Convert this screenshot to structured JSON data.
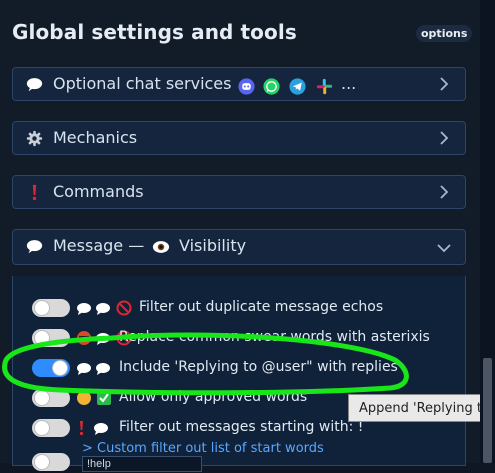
{
  "header": {
    "title": "Global settings and tools",
    "options_label": "options"
  },
  "sections": [
    {
      "icon": "speech-bubble-icon",
      "label": "Optional chat services",
      "services": [
        "discord-icon",
        "whatsapp-icon",
        "telegram-icon",
        "slack-icon"
      ],
      "ellipsis": "...",
      "expanded": false
    },
    {
      "icon": "gear-icon",
      "label": "Mechanics",
      "expanded": false
    },
    {
      "icon": "exclamation-icon",
      "label": "Commands",
      "expanded": false
    },
    {
      "icon": "speech-bubble-icon",
      "label_left": "Message —",
      "label_icon": "eye-icon",
      "label_right": "Visibility",
      "expanded": true
    }
  ],
  "visibility_rows": [
    {
      "on": false,
      "text": "Filter out duplicate message echos"
    },
    {
      "on": false,
      "text": "Replace common swear words with asterixis"
    },
    {
      "on": true,
      "text": "Include 'Replying to @user\" with replies"
    },
    {
      "on": false,
      "text": "Allow only approved words"
    },
    {
      "on": false,
      "text": "Filter out messages starting with: !"
    }
  ],
  "custom_filter_link": "> Custom filter out list of start words",
  "custom_filter_value": "!help",
  "tooltip": "Append 'Replying to",
  "colors": {
    "accent": "#2f8cff",
    "highlight": "#19e619",
    "panel": "#14253d"
  }
}
